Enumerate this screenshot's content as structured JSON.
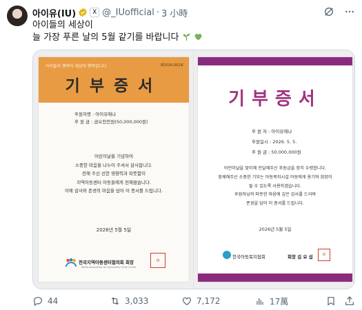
{
  "author": {
    "display_name": "아이유(IU)",
    "handle": "@_IUofficial",
    "separator": "·",
    "time": "3 小時",
    "affiliate_badge": "X"
  },
  "tweet": {
    "line1": "아이들의 세상이",
    "line2": "늘 가장 푸른 날의 5월 같기를 바랍니다"
  },
  "cert_left": {
    "band_sub": "아이들의 행복이 세상의 행복입니다",
    "band_no": "제2026-002호",
    "title": "기부증서",
    "donor": "후원자명 : 아이유애나",
    "amount": "후 원 금 : 금오천만원(50,000,000원)",
    "body": [
      "어린이날을 기념하여",
      "소중한 마음을 나누어 주셔서 감사합니다.",
      "전해 주신 선한 영향력과 따뜻함이",
      "지역아동센터 아동들에게 전해졌습니다.",
      "이에 감사와 존경의 마음을 담아 이 증서를 드립니다."
    ],
    "date": "2026년 5월 5일",
    "org": "전국지역아동센터협의회 회장",
    "org_en": "Korea Association of Community Child Center",
    "seal": "印"
  },
  "cert_right": {
    "title": "기부증서",
    "donor": "후 원 자 : 아이유애나",
    "donate_date": "후원일시 : 2026. 5. 5.",
    "amount": "후 원 금 : 50,000,000원",
    "body": [
      "어린이날을 맞이해 전달해주신 후원금을 정히 수령합니다.",
      "함께해주신 소중한 기부는 아동복지시설 아동에게 용기와 희망이",
      "될 수 있도록 사용하겠습니다.",
      "후원자님의 따뜻한 마음에 깊은 감사를 드리며",
      "존경을 담아 이 증서를 드립니다."
    ],
    "date": "2026년 5월 5일",
    "org": "한국아동복지협회",
    "chair": "회장 김 요 섭",
    "seal": "印"
  },
  "actions": {
    "replies": "44",
    "retweets": "3,033",
    "likes": "7,172",
    "views": "17萬"
  },
  "colors": {
    "orange_band": "#e89b42",
    "purple_bar": "#8a2c7e",
    "verified_gold": "#e2b719",
    "grok_gray": "#536471"
  },
  "icons": [
    "verified-badge-icon",
    "grok-icon",
    "more-icon",
    "seedling-emoji-icon",
    "green-heart-emoji-icon",
    "reply-icon",
    "retweet-icon",
    "like-icon",
    "views-icon",
    "bookmark-icon",
    "share-icon"
  ]
}
